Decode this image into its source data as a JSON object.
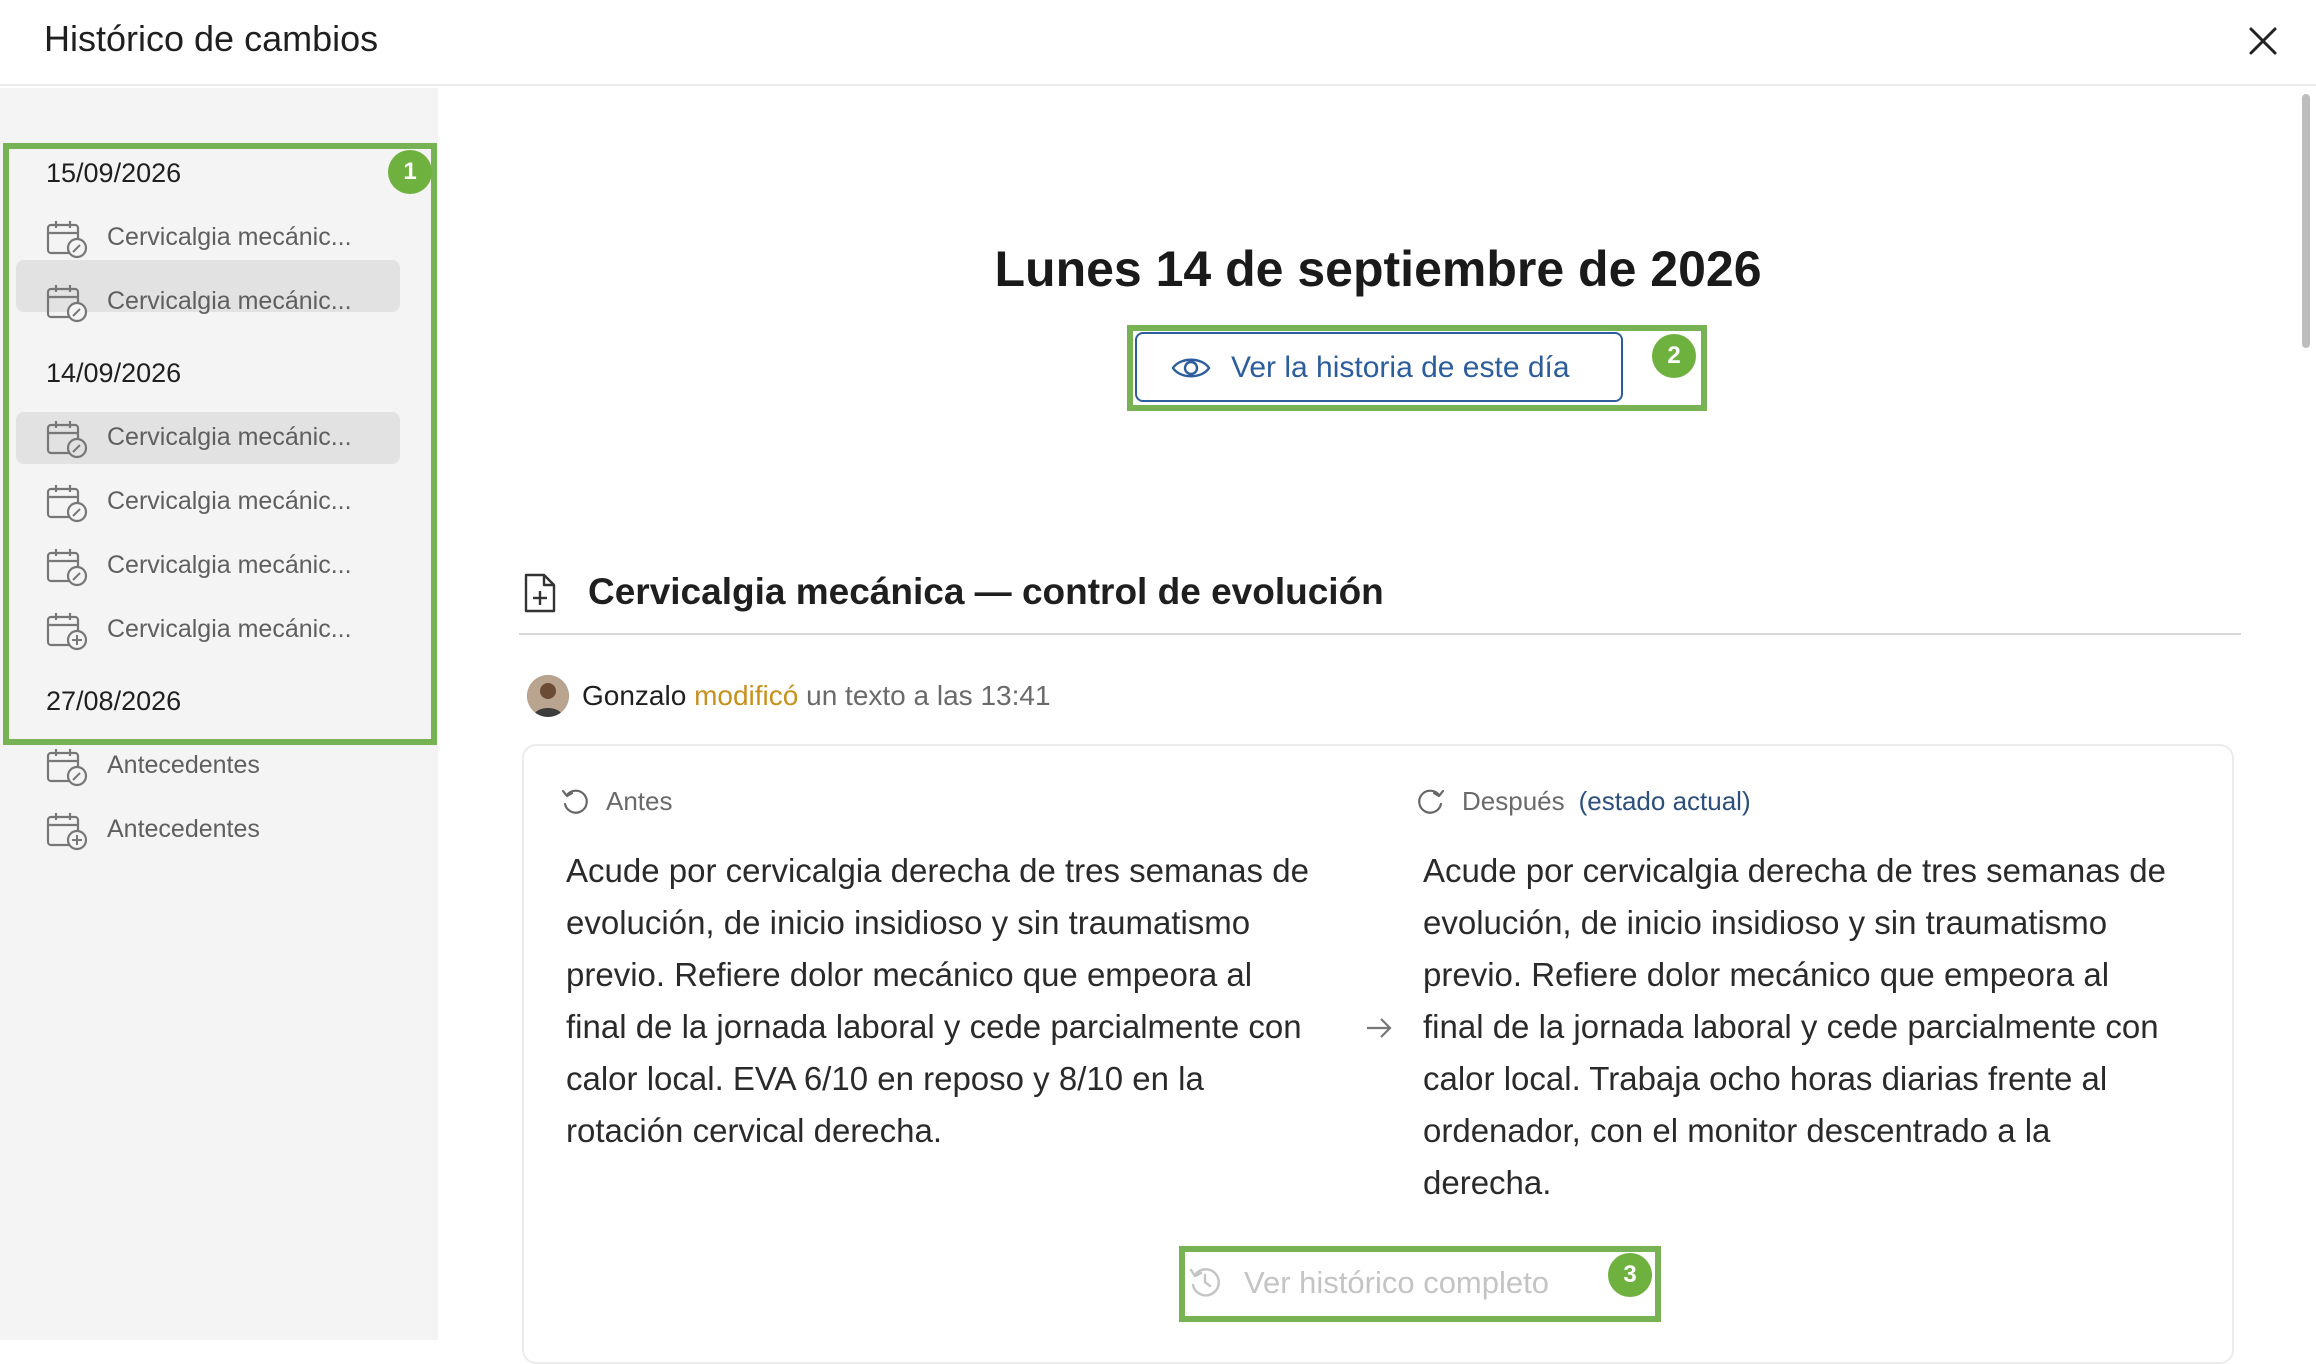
{
  "header": {
    "title": "Histórico de cambios",
    "close_icon": "close-icon"
  },
  "sidebar": {
    "groups": [
      {
        "date": "15/09/2026",
        "items": [
          {
            "label": "Cervicalgia mecánic...",
            "icon": "calendar-edit-icon"
          },
          {
            "label": "Cervicalgia mecánic...",
            "icon": "calendar-edit-icon"
          }
        ]
      },
      {
        "date": "14/09/2026",
        "selected": true,
        "items": [
          {
            "label": "Cervicalgia mecánic...",
            "icon": "calendar-edit-icon",
            "selected": true
          },
          {
            "label": "Cervicalgia mecánic...",
            "icon": "calendar-edit-icon"
          },
          {
            "label": "Cervicalgia mecánic...",
            "icon": "calendar-edit-icon"
          },
          {
            "label": "Cervicalgia mecánic...",
            "icon": "calendar-add-icon"
          }
        ]
      },
      {
        "date": "27/08/2026",
        "items": [
          {
            "label": "Antecedentes",
            "icon": "calendar-edit-icon"
          },
          {
            "label": "Antecedentes",
            "icon": "calendar-add-icon"
          }
        ]
      }
    ]
  },
  "annotations": {
    "badge_1": "1",
    "badge_2": "2",
    "badge_3": "3",
    "highlight_color": "#77b255"
  },
  "main": {
    "day_title": "Lunes 14 de septiembre de 2026",
    "view_day_button": "Ver la historia de este día",
    "section_title": "Cervicalgia mecánica — control de evolución",
    "change": {
      "author": "Gonzalo",
      "action": "modificó",
      "meta": "un texto a las 13:41"
    },
    "before": {
      "heading": "Antes",
      "lines": [
        "Acude por cervicalgia derecha de tres semanas de",
        "evolución, de inicio insidioso y sin traumatismo",
        "previo. Refiere dolor mecánico que empeora al",
        "final de la jornada laboral y cede parcialmente con",
        "calor local. EVA 6/10 en reposo y 8/10 en la",
        "rotación cervical derecha."
      ]
    },
    "after": {
      "heading": "Después",
      "current_tag": "(estado actual)",
      "lines": [
        "Acude por cervicalgia derecha de tres semanas de",
        "evolución, de inicio insidioso y sin traumatismo",
        "previo. Refiere dolor mecánico que empeora al",
        "final de la jornada laboral y cede parcialmente con",
        "calor local. Trabaja ocho horas diarias frente al",
        "ordenador, con el monitor descentrado a la",
        "derecha."
      ]
    },
    "full_history_button": "Ver histórico completo"
  },
  "colors": {
    "accent_blue": "#2c5d9c",
    "action_orange": "#c8901d",
    "sidebar_bg": "#f4f4f4",
    "selection_bg": "#e2e2e2"
  }
}
